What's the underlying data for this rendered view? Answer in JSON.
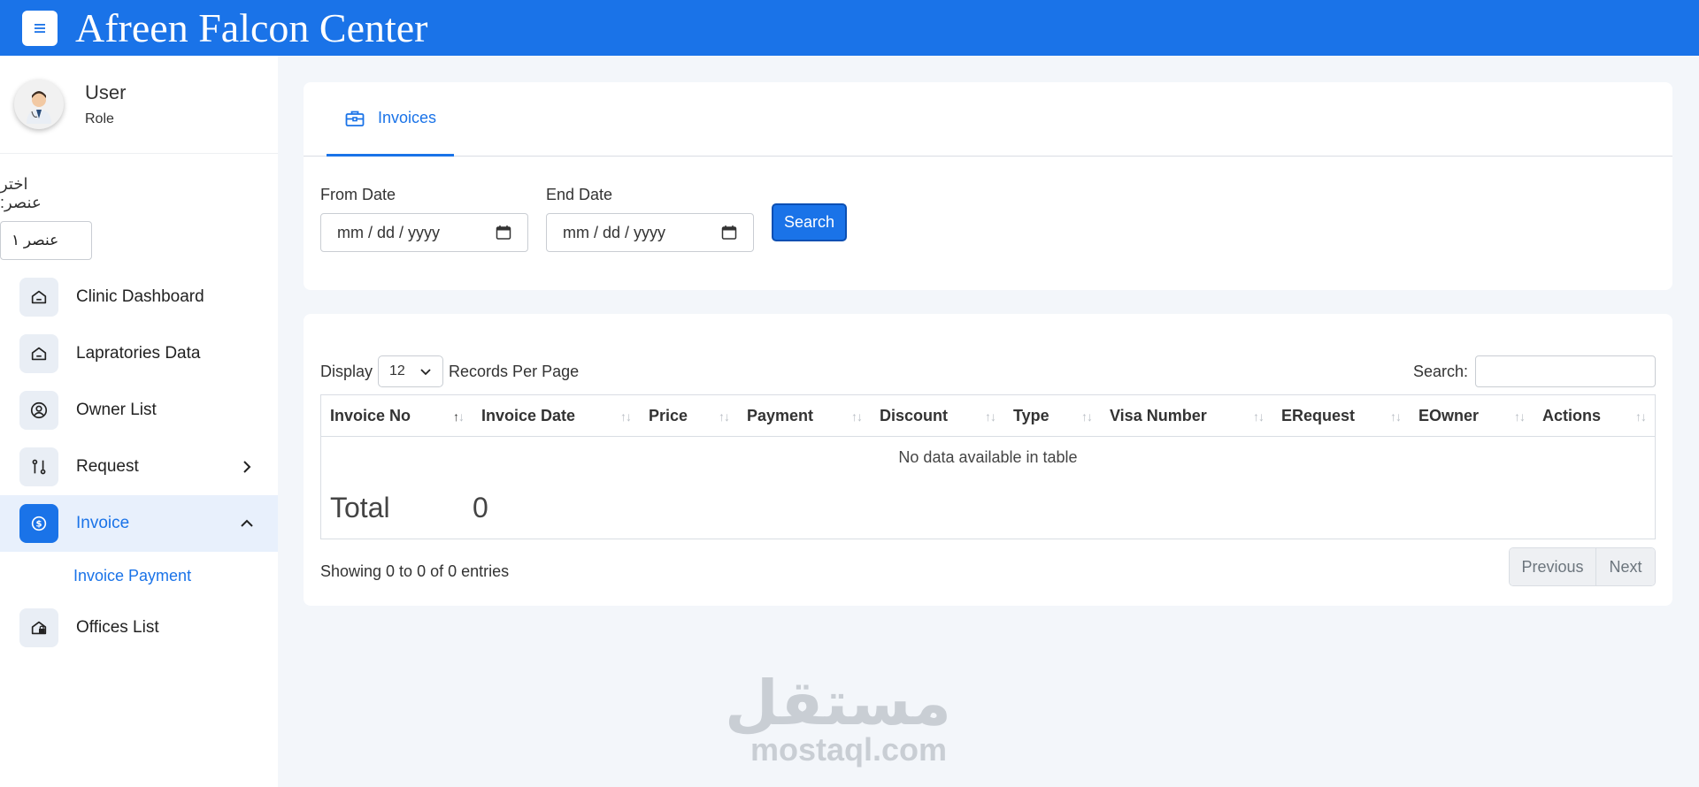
{
  "header": {
    "title": "Afreen Falcon Center",
    "menu_icon": "hamburger-icon"
  },
  "sidebar": {
    "user": {
      "name": "User",
      "role": "Role",
      "avatar_icon": "doctor-avatar-icon"
    },
    "select_label": "اختر عنصر:",
    "select_value": "عنصر ١",
    "items": [
      {
        "label": "Clinic Dashboard",
        "icon": "home-icon"
      },
      {
        "label": "Lapratories Data",
        "icon": "home-icon"
      },
      {
        "label": "Owner List",
        "icon": "user-circle-icon"
      },
      {
        "label": "Request",
        "icon": "route-icon",
        "chevron": "chevron-right-icon"
      },
      {
        "label": "Invoice",
        "icon": "dollar-circle-icon",
        "chevron": "chevron-up-icon",
        "active": true
      },
      {
        "label": "Offices List",
        "icon": "house-lock-icon"
      }
    ],
    "sub_items": [
      {
        "label": "Invoice Payment"
      }
    ]
  },
  "filter_card": {
    "tab_label": "Invoices",
    "tab_icon": "briefcase-icon",
    "from_label": "From Date",
    "from_placeholder": "mm / dd / yyyy",
    "end_label": "End Date",
    "end_placeholder": "mm / dd / yyyy",
    "search_button": "Search"
  },
  "table_card": {
    "display_label": "Display",
    "per_page_value": "12",
    "records_label": "Records Per Page",
    "search_label": "Search:",
    "columns": [
      "Invoice No",
      "Invoice Date",
      "Price",
      "Payment",
      "Discount",
      "Type",
      "Visa Number",
      "ERequest",
      "EOwner",
      "Actions"
    ],
    "empty_message": "No data available in table",
    "total_label": "Total",
    "total_value": "0",
    "info": "Showing 0 to 0 of 0 entries",
    "prev": "Previous",
    "next": "Next"
  },
  "watermark": {
    "arabic": "مستقل",
    "latin": "mostaql.com"
  },
  "colors": {
    "primary": "#1a73e8",
    "background": "#f3f6fa"
  }
}
